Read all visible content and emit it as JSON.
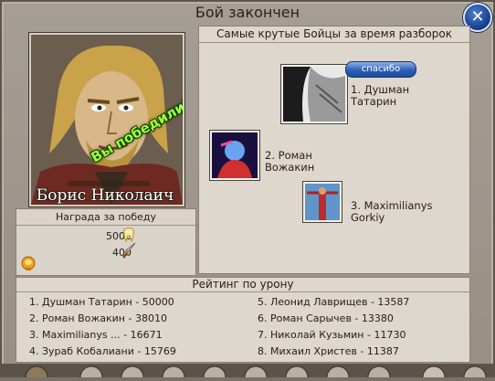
{
  "dialog": {
    "title": "Бой закончен",
    "close_symbol": "✕"
  },
  "hero": {
    "name": "Борис Николаич",
    "victory_text": "Вы победили!"
  },
  "reward": {
    "header": "Награда за победу",
    "gold": "5000",
    "gold_icon": "tooth-icon",
    "exp": "400",
    "exp_icon": "sword-icon"
  },
  "top_fighters": {
    "header": "Самые крутые Бойцы за время разборок",
    "thanks_label": "спасибо",
    "fighters": [
      {
        "line1": "1. Душман",
        "line2": "Татарин"
      },
      {
        "line1": "2. Роман",
        "line2": "Вожакин"
      },
      {
        "line1": "3. Maximilianys",
        "line2": "Gorkiy"
      }
    ]
  },
  "rating": {
    "header": "Рейтинг по урону",
    "left": [
      "1. Душман Татарин - 50000",
      "2. Роман Вожакин - 38010",
      "3. Maximilianys ... - 16671",
      "4. Зураб Кобалиани - 15769"
    ],
    "right": [
      "5. Леонид Лаврищев - 13587",
      "6. Роман Сарычев - 13380",
      "7. Николай Кузьмин - 11730",
      "8. Михаил Христев - 11387"
    ]
  }
}
